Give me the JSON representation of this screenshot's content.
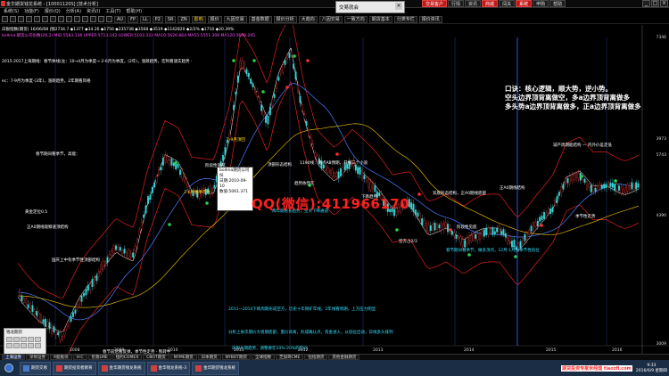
{
  "window": {
    "title": "金华期货钱龙系统 - [10001120S] [技术分析]"
  },
  "trade_dialog": {
    "title": "交易就会",
    "close": "×"
  },
  "header_buttons": [
    "交易客户",
    "行情",
    "资讯",
    "商城",
    "闯关",
    "系统",
    "申购",
    "帮助"
  ],
  "menubar": {
    "items": [
      "系统(S)",
      "功能(F)",
      "报价(Q)",
      "分析(A)",
      "资讯(I)",
      "工具(T)",
      "帮助(H)"
    ]
  },
  "toolbar": {
    "buttons": [
      "AU",
      "FP",
      "LL",
      "P2",
      "SR",
      "ZN",
      "影响",
      "报价",
      "九因交易",
      "基金数据",
      "报价分析",
      "大趋向",
      "八因交易",
      "一致方向",
      "期货基本",
      "分类专栏",
      "报价资讯"
    ]
  },
  "chart": {
    "info_lines": [
      {
        "text": "白银指数(期货) 16/06/08 |钱2734.7 ◆1377 ◆34.26 ◆1750 ◆235738 ◆3568 ◆3519 ◆1142820 ◆2/2% ◆1710 ◆20.39%",
        "color": "#ffffff"
      },
      {
        "text": "bollma.期货公司份数(26,2) MID:5583.136 UPPER:5713.142 LOWER:5193.333 MA10:5626.864 MA55:5551.306 MA120:5698.205",
        "color": "#ff4fff"
      }
    ],
    "price_labels": [
      "7346",
      "3973",
      "5743",
      "4390",
      "3009"
    ],
    "year_labels": [
      "2008",
      "2009",
      "2010",
      "2011",
      "2012",
      "2013",
      "2014",
      "2015",
      "2016"
    ],
    "notes": [
      {
        "text": "2015-2017上海期线：春节休线(左：10→4月为季度→ 2-6月为季度，(2年)，涨跌趋势。宏利看速实趋势 ·",
        "cls": ""
      },
      {
        "text": "ec：7·9月为季度·(3年)，涨跌趋势。2年期看风格",
        "cls": ""
      },
      {
        "text": "黄金定位0.5",
        "cls": ""
      },
      {
        "text": "正A0期线观察速顶结构",
        "cls": ""
      },
      {
        "text": "春节期间看季节，高能：",
        "cls": ""
      },
      {
        "text": "国庆上中有季节性顶部结构",
        "cls": ""
      },
      {
        "text": "2-6月底季节性",
        "cls": "yel"
      },
      {
        "text": "7-9月顶回",
        "cls": "yel"
      },
      {
        "text": "阶段性顶部",
        "cls": ""
      },
      {
        "text": "顶部形态结构",
        "cls": ""
      },
      {
        "text": "1190线：热点AB预期，日线三个小浪",
        "cls": ""
      },
      {
        "text": "趋势依然在",
        "cls": ""
      },
      {
        "text": "两年期看长趋势，空头下降通道",
        "cls": "cy"
      },
      {
        "text": "下跌趋势",
        "cls": ""
      },
      {
        "text": "空方占2/3",
        "cls": ""
      },
      {
        "text": "阶段性见底",
        "cls": ""
      },
      {
        "text": "双底形态结构，正A0期线底部",
        "cls": ""
      },
      {
        "text": "正A0期线结构",
        "cls": ""
      },
      {
        "text": "减产周期能结构 — 内外价差走低",
        "cls": ""
      },
      {
        "text": "2011—2014下跌周期形成空方，历史十年铜矿年线，2年线看周期，上方压力明显",
        "cls": "cy"
      },
      {
        "text": "分析上依次期价大周期底部，量价背离，形成确认点，资金进入，从低位启动，日线多头排列",
        "cls": "cy"
      },
      {
        "text": "春节前后看反弹，季节性走势 · 熊转牛",
        "cls": ""
      },
      {
        "text": "白银长期趋势，调整要在10%-20%的空间",
        "cls": "cy"
      },
      {
        "text": "春节期间看季节，做多顶点，12月-1月为季节性低位",
        "cls": "cy"
      },
      {
        "text": "季节性走势",
        "cls": ""
      },
      {
        "text": "春节前后看季节，高位15%，春节周期结构",
        "cls": ""
      }
    ],
    "tooltip": {
      "title": "bollma期货公司份",
      "lines": [
        "日期:2010-09-10",
        "数值:5061.371"
      ]
    },
    "watermark": "QQ(微信):411966170",
    "promo": [
      "口诀：核心逻辑，顺大势，逆小势。",
      "空头边界顶背离做空，多a边界顶背离做多",
      "多头势a边界顶背离做多，正a边界顶背离做多"
    ]
  },
  "bottom_tabs": [
    "上海证券",
    "深圳证券",
    "A股板块",
    "H·C",
    "伦敦LME",
    "纽约COMEX",
    "CBOT期货",
    "NYME期货",
    "日本期货",
    "NYBOT期货",
    "全球指数",
    "芝加哥CME",
    "恒指期货",
    "其他金融期货"
  ],
  "mini_panel": {
    "title": "钱龙期货"
  },
  "taskbar": {
    "tasks": [
      "期货交易",
      "期货投资者教育",
      "金华期货钱龙系统",
      "金华钱龙系统-3",
      "金华期货钱龙系统"
    ],
    "brand": "期货投资专家米经理  tiaozfi.com",
    "clock_time": "9:33",
    "clock_date": "2016/6/9 星期四"
  }
}
